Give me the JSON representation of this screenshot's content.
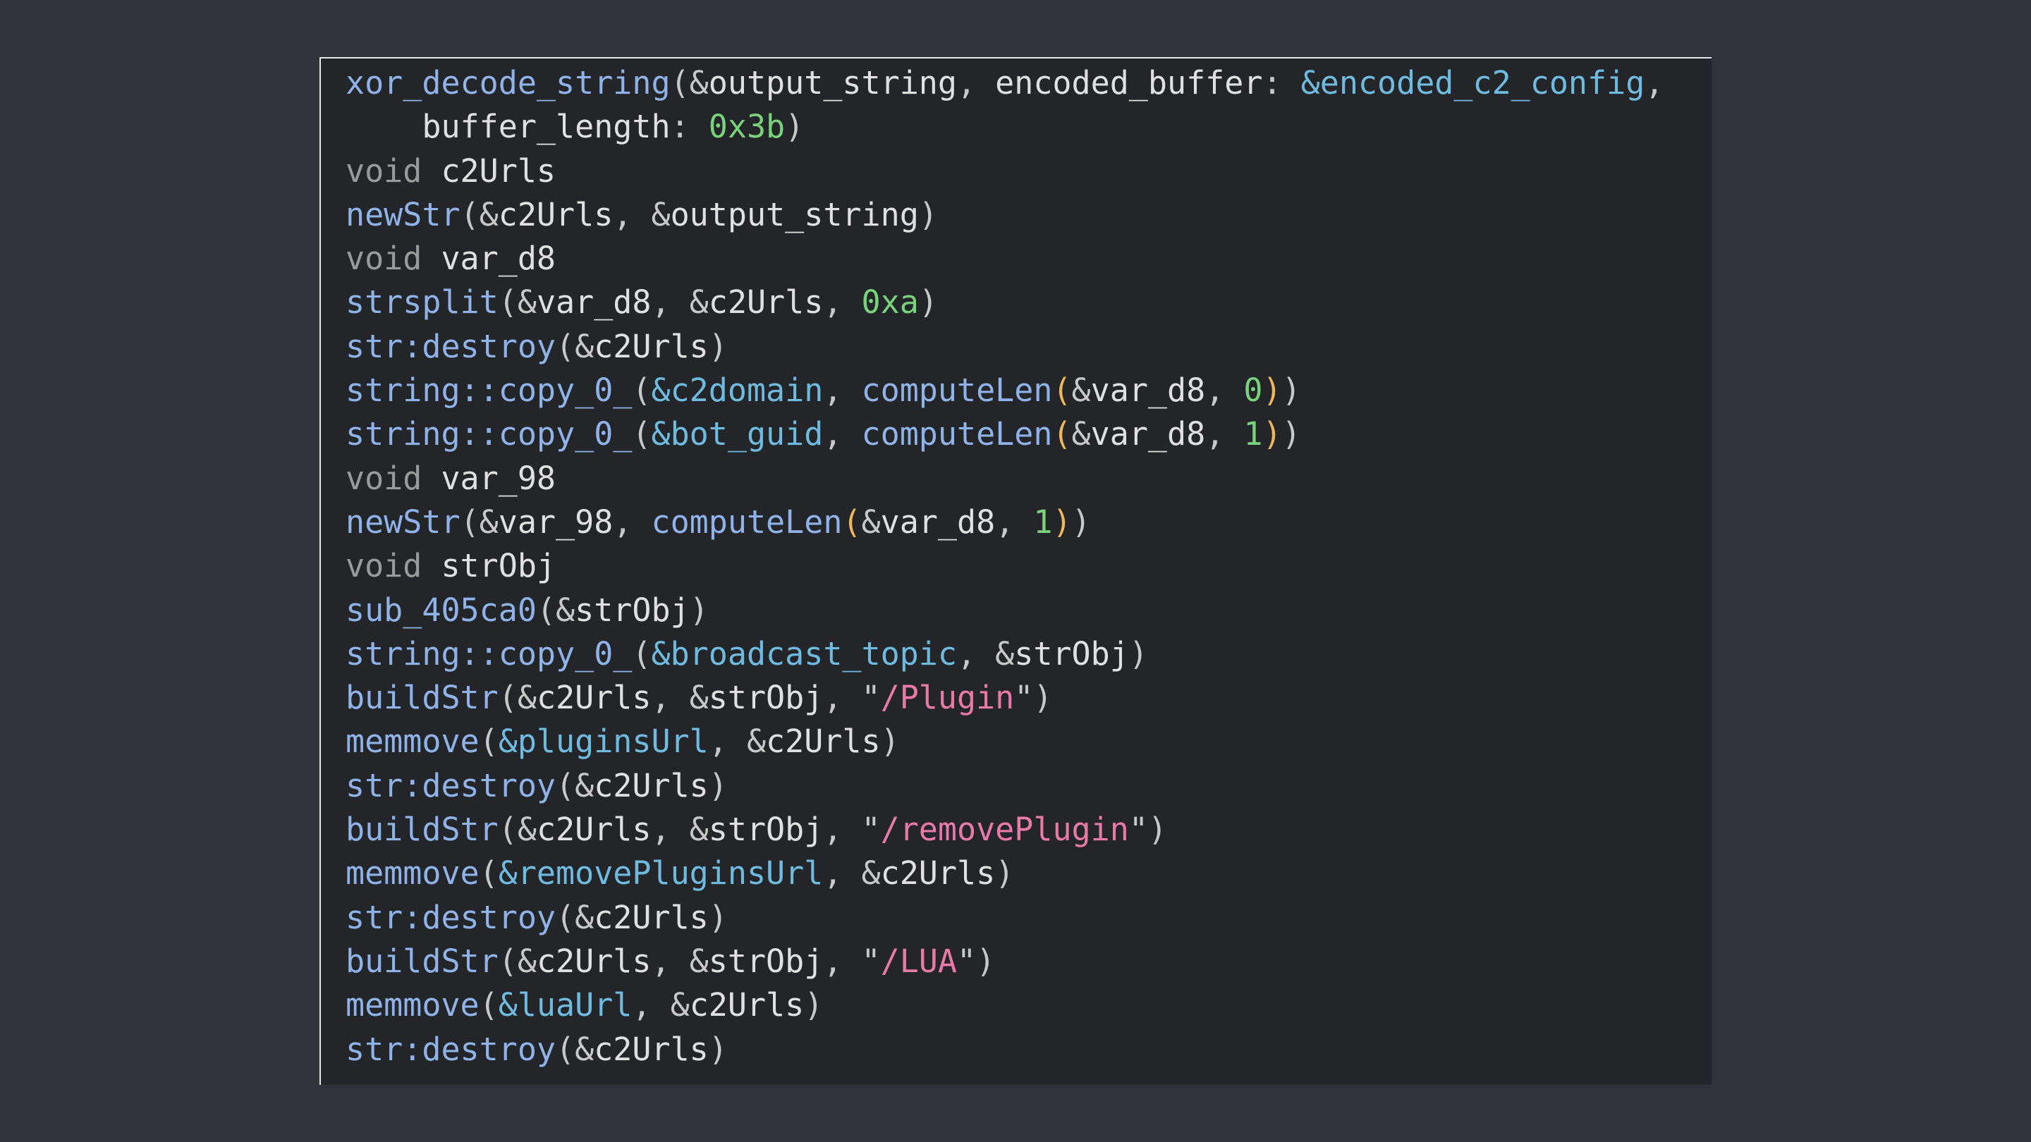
{
  "colors": {
    "page_background": "#30343a",
    "code_background": "#232528",
    "function": "#8fb3e8",
    "keyword": "#9a9a9a",
    "identifier": "#e0e0e0",
    "number": "#79d27c",
    "global_variable": "#6fbbe0",
    "string": "#e87aa6",
    "punctuation": "#c8c8c8",
    "paren_highlight": "#f0b65a"
  },
  "code": {
    "lines": [
      [
        {
          "t": "xor_decode_string",
          "c": "fn"
        },
        {
          "t": "(&",
          "c": "punct"
        },
        {
          "t": "output_string",
          "c": "id"
        },
        {
          "t": ", ",
          "c": "punct"
        },
        {
          "t": "encoded_buffer",
          "c": "id"
        },
        {
          "t": ": ",
          "c": "punct"
        },
        {
          "t": "&encoded_c2_config",
          "c": "gvar"
        },
        {
          "t": ",",
          "c": "punct"
        }
      ],
      [
        {
          "t": "    buffer_length",
          "c": "id"
        },
        {
          "t": ": ",
          "c": "punct"
        },
        {
          "t": "0x3b",
          "c": "num"
        },
        {
          "t": ")",
          "c": "punct"
        }
      ],
      [
        {
          "t": "void",
          "c": "kw"
        },
        {
          "t": " c2Urls",
          "c": "id"
        }
      ],
      [
        {
          "t": "newStr",
          "c": "fn"
        },
        {
          "t": "(&",
          "c": "punct"
        },
        {
          "t": "c2Urls",
          "c": "id"
        },
        {
          "t": ", &",
          "c": "punct"
        },
        {
          "t": "output_string",
          "c": "id"
        },
        {
          "t": ")",
          "c": "punct"
        }
      ],
      [
        {
          "t": "void",
          "c": "kw"
        },
        {
          "t": " var_d8",
          "c": "id"
        }
      ],
      [
        {
          "t": "strsplit",
          "c": "fn"
        },
        {
          "t": "(&",
          "c": "punct"
        },
        {
          "t": "var_d8",
          "c": "id"
        },
        {
          "t": ", &",
          "c": "punct"
        },
        {
          "t": "c2Urls",
          "c": "id"
        },
        {
          "t": ", ",
          "c": "punct"
        },
        {
          "t": "0xa",
          "c": "num"
        },
        {
          "t": ")",
          "c": "punct"
        }
      ],
      [
        {
          "t": "str:destroy",
          "c": "fn"
        },
        {
          "t": "(&",
          "c": "punct"
        },
        {
          "t": "c2Urls",
          "c": "id"
        },
        {
          "t": ")",
          "c": "punct"
        }
      ],
      [
        {
          "t": "string::copy_0_",
          "c": "fn"
        },
        {
          "t": "(",
          "c": "punct"
        },
        {
          "t": "&c2domain",
          "c": "gvar"
        },
        {
          "t": ", ",
          "c": "punct"
        },
        {
          "t": "computeLen",
          "c": "fn"
        },
        {
          "t": "(",
          "c": "paren"
        },
        {
          "t": "&",
          "c": "punct"
        },
        {
          "t": "var_d8",
          "c": "id"
        },
        {
          "t": ", ",
          "c": "punct"
        },
        {
          "t": "0",
          "c": "num"
        },
        {
          "t": ")",
          "c": "paren"
        },
        {
          "t": ")",
          "c": "punct"
        }
      ],
      [
        {
          "t": "string::copy_0_",
          "c": "fn"
        },
        {
          "t": "(",
          "c": "punct"
        },
        {
          "t": "&bot_guid",
          "c": "gvar"
        },
        {
          "t": ", ",
          "c": "punct"
        },
        {
          "t": "computeLen",
          "c": "fn"
        },
        {
          "t": "(",
          "c": "paren"
        },
        {
          "t": "&",
          "c": "punct"
        },
        {
          "t": "var_d8",
          "c": "id"
        },
        {
          "t": ", ",
          "c": "punct"
        },
        {
          "t": "1",
          "c": "num"
        },
        {
          "t": ")",
          "c": "paren"
        },
        {
          "t": ")",
          "c": "punct"
        }
      ],
      [
        {
          "t": "void",
          "c": "kw"
        },
        {
          "t": " var_98",
          "c": "id"
        }
      ],
      [
        {
          "t": "newStr",
          "c": "fn"
        },
        {
          "t": "(&",
          "c": "punct"
        },
        {
          "t": "var_98",
          "c": "id"
        },
        {
          "t": ", ",
          "c": "punct"
        },
        {
          "t": "computeLen",
          "c": "fn"
        },
        {
          "t": "(",
          "c": "paren"
        },
        {
          "t": "&",
          "c": "punct"
        },
        {
          "t": "var_d8",
          "c": "id"
        },
        {
          "t": ", ",
          "c": "punct"
        },
        {
          "t": "1",
          "c": "num"
        },
        {
          "t": ")",
          "c": "paren"
        },
        {
          "t": ")",
          "c": "punct"
        }
      ],
      [
        {
          "t": "void",
          "c": "kw"
        },
        {
          "t": " strObj",
          "c": "id"
        }
      ],
      [
        {
          "t": "sub_405ca0",
          "c": "fn"
        },
        {
          "t": "(&",
          "c": "punct"
        },
        {
          "t": "strObj",
          "c": "id"
        },
        {
          "t": ")",
          "c": "punct"
        }
      ],
      [
        {
          "t": "string::copy_0_",
          "c": "fn"
        },
        {
          "t": "(",
          "c": "punct"
        },
        {
          "t": "&broadcast_topic",
          "c": "gvar"
        },
        {
          "t": ", &",
          "c": "punct"
        },
        {
          "t": "strObj",
          "c": "id"
        },
        {
          "t": ")",
          "c": "punct"
        }
      ],
      [
        {
          "t": "buildStr",
          "c": "fn"
        },
        {
          "t": "(&",
          "c": "punct"
        },
        {
          "t": "c2Urls",
          "c": "id"
        },
        {
          "t": ", &",
          "c": "punct"
        },
        {
          "t": "strObj",
          "c": "id"
        },
        {
          "t": ", \"",
          "c": "punct"
        },
        {
          "t": "/Plugin",
          "c": "str"
        },
        {
          "t": "\")",
          "c": "punct"
        }
      ],
      [
        {
          "t": "memmove",
          "c": "fn"
        },
        {
          "t": "(",
          "c": "punct"
        },
        {
          "t": "&pluginsUrl",
          "c": "gvar"
        },
        {
          "t": ", &",
          "c": "punct"
        },
        {
          "t": "c2Urls",
          "c": "id"
        },
        {
          "t": ")",
          "c": "punct"
        }
      ],
      [
        {
          "t": "str:destroy",
          "c": "fn"
        },
        {
          "t": "(&",
          "c": "punct"
        },
        {
          "t": "c2Urls",
          "c": "id"
        },
        {
          "t": ")",
          "c": "punct"
        }
      ],
      [
        {
          "t": "buildStr",
          "c": "fn"
        },
        {
          "t": "(&",
          "c": "punct"
        },
        {
          "t": "c2Urls",
          "c": "id"
        },
        {
          "t": ", &",
          "c": "punct"
        },
        {
          "t": "strObj",
          "c": "id"
        },
        {
          "t": ", \"",
          "c": "punct"
        },
        {
          "t": "/removePlugin",
          "c": "str"
        },
        {
          "t": "\")",
          "c": "punct"
        }
      ],
      [
        {
          "t": "memmove",
          "c": "fn"
        },
        {
          "t": "(",
          "c": "punct"
        },
        {
          "t": "&removePluginsUrl",
          "c": "gvar"
        },
        {
          "t": ", &",
          "c": "punct"
        },
        {
          "t": "c2Urls",
          "c": "id"
        },
        {
          "t": ")",
          "c": "punct"
        }
      ],
      [
        {
          "t": "str:destroy",
          "c": "fn"
        },
        {
          "t": "(&",
          "c": "punct"
        },
        {
          "t": "c2Urls",
          "c": "id"
        },
        {
          "t": ")",
          "c": "punct"
        }
      ],
      [
        {
          "t": "buildStr",
          "c": "fn"
        },
        {
          "t": "(&",
          "c": "punct"
        },
        {
          "t": "c2Urls",
          "c": "id"
        },
        {
          "t": ", &",
          "c": "punct"
        },
        {
          "t": "strObj",
          "c": "id"
        },
        {
          "t": ", \"",
          "c": "punct"
        },
        {
          "t": "/LUA",
          "c": "str"
        },
        {
          "t": "\")",
          "c": "punct"
        }
      ],
      [
        {
          "t": "memmove",
          "c": "fn"
        },
        {
          "t": "(",
          "c": "punct"
        },
        {
          "t": "&luaUrl",
          "c": "gvar"
        },
        {
          "t": ", &",
          "c": "punct"
        },
        {
          "t": "c2Urls",
          "c": "id"
        },
        {
          "t": ")",
          "c": "punct"
        }
      ],
      [
        {
          "t": "str:destroy",
          "c": "fn"
        },
        {
          "t": "(&",
          "c": "punct"
        },
        {
          "t": "c2Urls",
          "c": "id"
        },
        {
          "t": ")",
          "c": "punct"
        }
      ]
    ]
  }
}
